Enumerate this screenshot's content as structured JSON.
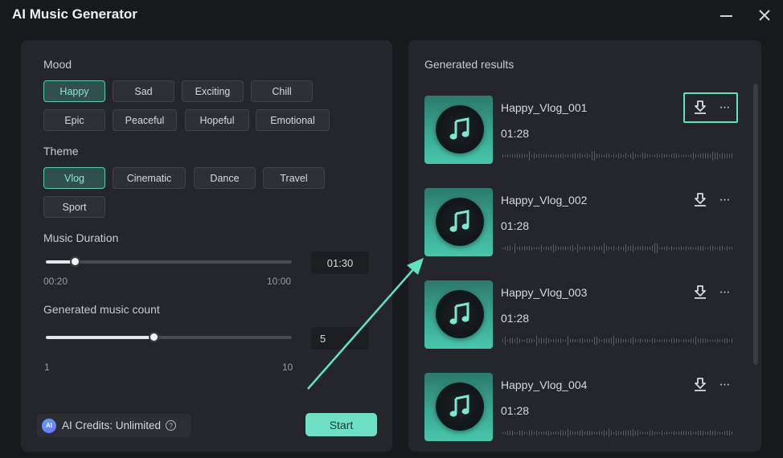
{
  "app": {
    "title": "AI Music Generator"
  },
  "mood": {
    "label": "Mood",
    "options": [
      "Happy",
      "Sad",
      "Exciting",
      "Chill",
      "Epic",
      "Peaceful",
      "Hopeful",
      "Emotional"
    ],
    "selected": "Happy"
  },
  "theme": {
    "label": "Theme",
    "options": [
      "Vlog",
      "Cinematic",
      "Dance",
      "Travel",
      "Sport"
    ],
    "selected": "Vlog"
  },
  "duration": {
    "label": "Music Duration",
    "min_label": "00:20",
    "max_label": "10:00",
    "value": "01:30",
    "fraction": 0.12
  },
  "count": {
    "label": "Generated music count",
    "min_label": "1",
    "max_label": "10",
    "value": "5",
    "fraction": 0.44
  },
  "credits": {
    "text": "AI Credits: Unlimited",
    "badge": "AI",
    "help": "?"
  },
  "actions": {
    "start_label": "Start"
  },
  "results": {
    "label": "Generated results",
    "items": [
      {
        "name": "Happy_Vlog_001",
        "duration": "01:28"
      },
      {
        "name": "Happy_Vlog_002",
        "duration": "01:28"
      },
      {
        "name": "Happy_Vlog_003",
        "duration": "01:28"
      },
      {
        "name": "Happy_Vlog_004",
        "duration": "01:28"
      }
    ],
    "more_glyph": "···"
  },
  "icons": {
    "minimize": "minimize-icon",
    "close": "close-icon",
    "download": "download-icon",
    "more": "more-icon",
    "music_note": "music-note-icon"
  },
  "colors": {
    "accent": "#6fe0c6",
    "highlight": "#5fe3c5",
    "panel": "#25262c",
    "background": "#18191d"
  }
}
